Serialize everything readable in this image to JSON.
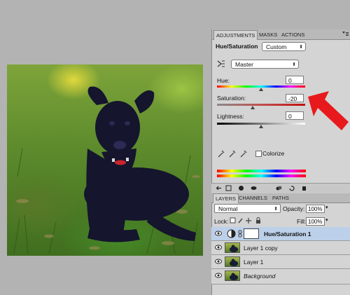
{
  "panel": {
    "tabs": [
      "ADJUSTMENTS",
      "MASKS",
      "ACTIONS"
    ],
    "title": "Hue/Saturation",
    "preset": "Custom",
    "edit": "Master",
    "hue": {
      "label": "Hue:",
      "value": "0"
    },
    "saturation": {
      "label": "Saturation:",
      "value": "-20"
    },
    "lightness": {
      "label": "Lightness:",
      "value": "0"
    },
    "colorize": "Colorize"
  },
  "layers": {
    "tabs": [
      "LAYERS",
      "CHANNELS",
      "PATHS"
    ],
    "blend_mode": "Normal",
    "opacity_label": "Opacity:",
    "opacity": "100%",
    "lock_label": "Lock:",
    "fill_label": "Fill:",
    "fill": "100%",
    "items": [
      {
        "name": "Hue/Saturation 1",
        "selected": true
      },
      {
        "name": "Layer 1 copy"
      },
      {
        "name": "Layer 1"
      },
      {
        "name": "Background",
        "italic": true
      }
    ]
  },
  "colors": {
    "accent_arrow": "#e8191c",
    "selection": "#bcd0e9"
  }
}
